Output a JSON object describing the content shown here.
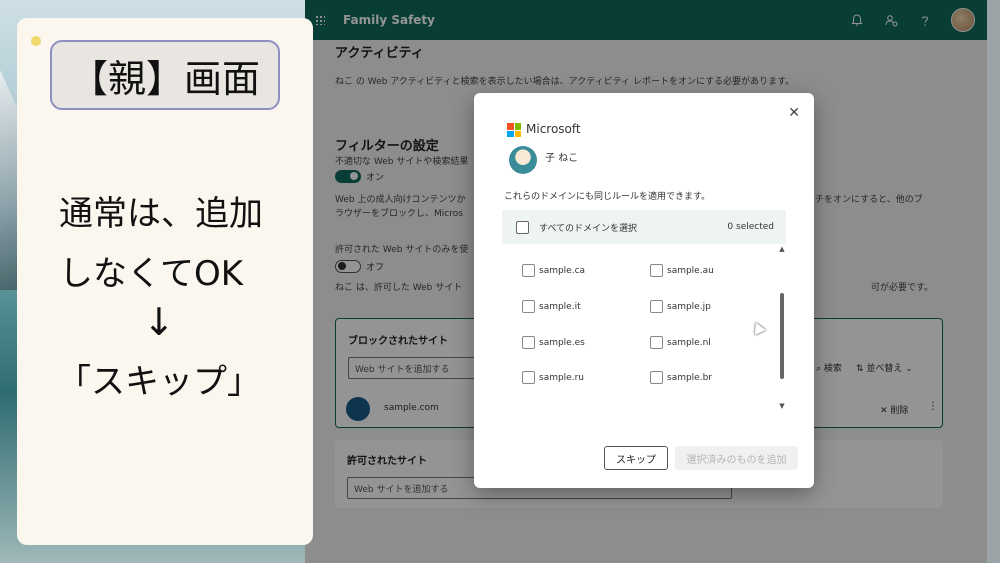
{
  "annotation": {
    "title": "【親】画面",
    "line1": "通常は、追加",
    "line2": "しなくてOK",
    "arrow": "↓",
    "line3": "「スキップ」"
  },
  "topbar": {
    "app_title": "Family Safety",
    "icons": [
      "bell-icon",
      "people-settings-icon",
      "help-icon",
      "avatar"
    ]
  },
  "activity": {
    "title": "アクティビティ",
    "description": "ねこ の Web アクティビティと検索を表示したい場合は、アクティビティ レポートをオンにする必要があります。"
  },
  "filter": {
    "title": "フィルターの設定",
    "line1": "不適切な Web サイトや検索結果",
    "toggle1_label": "オン",
    "desc_a": "Web 上の成人向けコンテンツか",
    "desc_a_right": "チをオンにすると、他のブ",
    "desc_b": "ラウザーをブロックし、Micros",
    "allowed_only": "許可された Web サイトのみを使",
    "toggle2_label": "オフ",
    "desc_c": "ねこ は、許可した Web サイト",
    "desc_c_right": "可が必要です。"
  },
  "blocked_sites": {
    "title": "ブロックされたサイト",
    "input_placeholder": "Web サイトを追加する",
    "search_label": "検索",
    "sort_label": "並べ替え",
    "site": "sample.com",
    "delete_label": "削除"
  },
  "allowed_sites": {
    "title": "許可されたサイト",
    "input_placeholder": "Web サイトを追加する"
  },
  "dialog": {
    "brand": "Microsoft",
    "child_name": "子 ねこ",
    "description": "これらのドメインにも同じルールを適用できます。",
    "select_all_label": "すべてのドメインを選択",
    "selected_count": "0 selected",
    "domains": {
      "d1": "sample.ca",
      "d2": "sample.au",
      "d3": "sample.it",
      "d4": "sample.jp",
      "d5": "sample.es",
      "d6": "sample.nl",
      "d7": "sample.ru",
      "d8": "sample.br"
    },
    "skip_label": "スキップ",
    "add_label": "選択済みのものを追加"
  }
}
